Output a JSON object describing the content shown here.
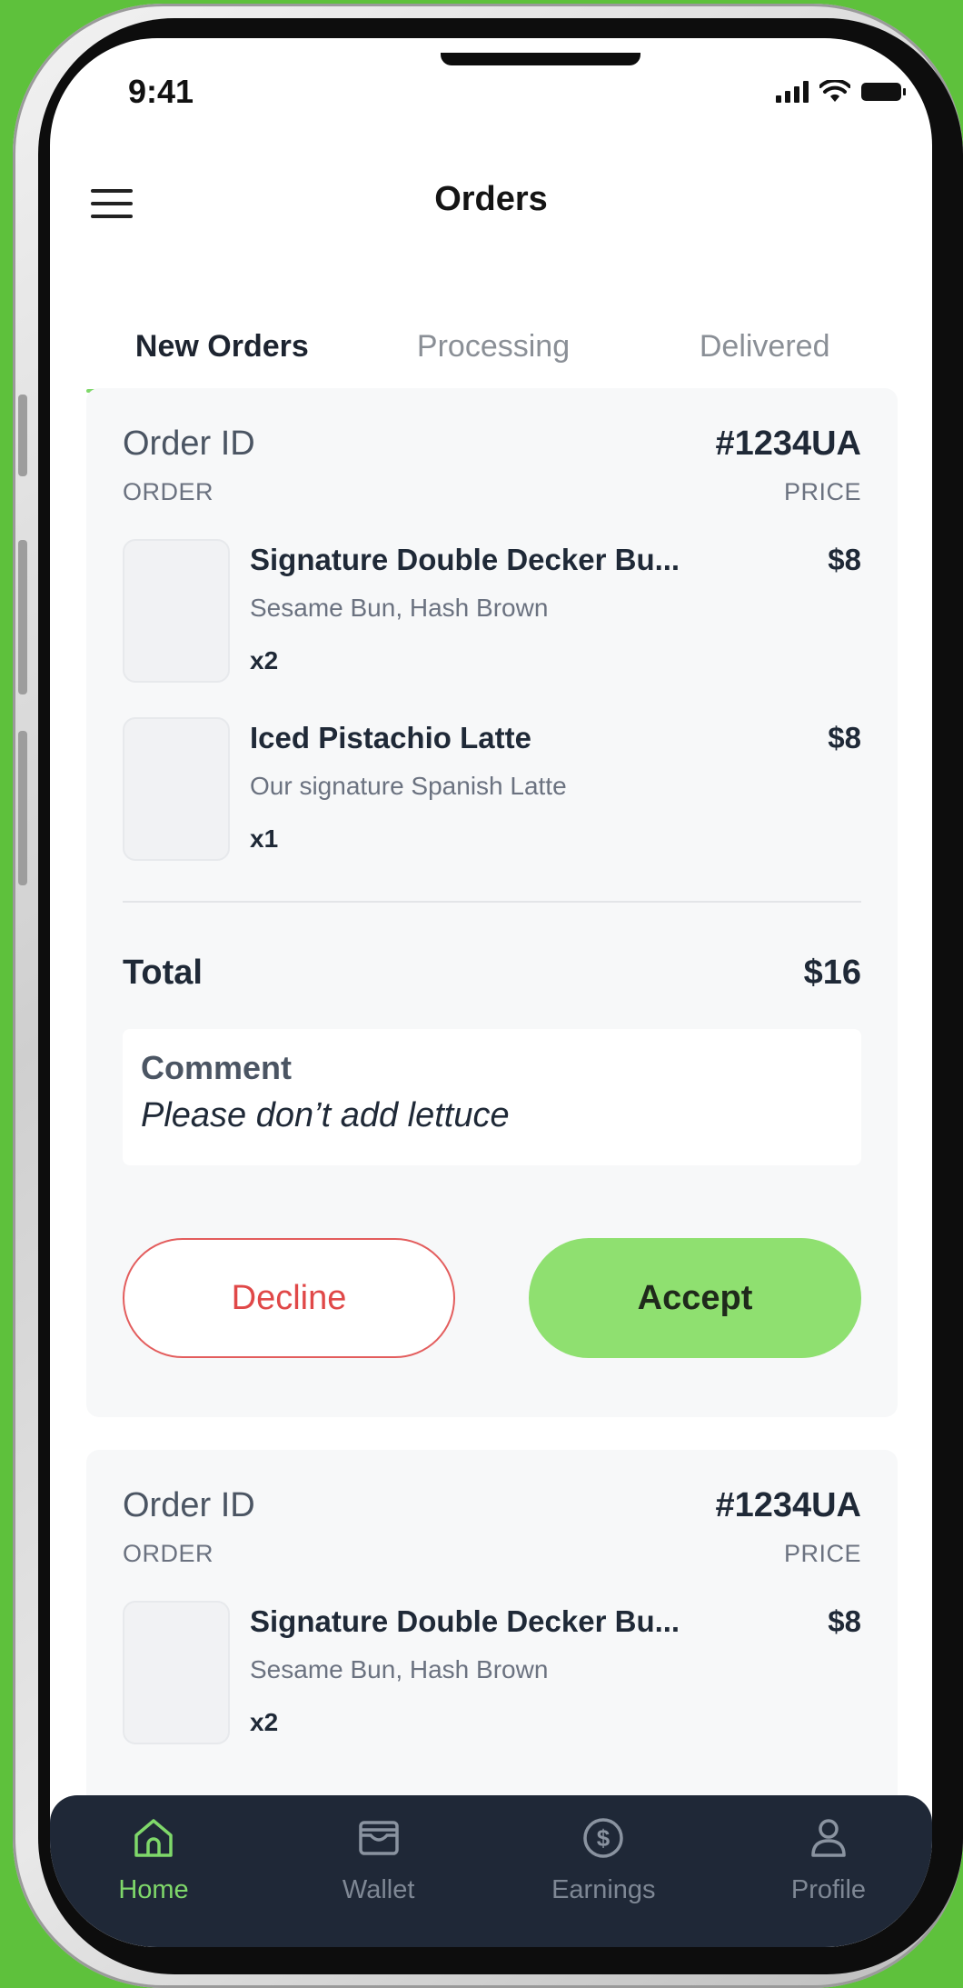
{
  "status_bar": {
    "time": "9:41"
  },
  "header": {
    "title": "Orders"
  },
  "tabs": [
    {
      "label": "New Orders",
      "active": true
    },
    {
      "label": "Processing",
      "active": false
    },
    {
      "label": "Delivered",
      "active": false
    }
  ],
  "orders": [
    {
      "id_label": "Order ID",
      "id_value": "#1234UA",
      "col_order": "ORDER",
      "col_price": "PRICE",
      "items": [
        {
          "name": "Signature Double Decker Bu...",
          "desc": "Sesame Bun, Hash Brown",
          "qty": "x2",
          "price": "$8"
        },
        {
          "name": "Iced Pistachio Latte",
          "desc": "Our signature Spanish Latte",
          "qty": "x1",
          "price": "$8"
        }
      ],
      "total_label": "Total",
      "total_value": "$16",
      "comment_label": "Comment",
      "comment_text": "Please don’t add lettuce",
      "decline_label": "Decline",
      "accept_label": "Accept"
    },
    {
      "id_label": "Order ID",
      "id_value": "#1234UA",
      "col_order": "ORDER",
      "col_price": "PRICE",
      "items": [
        {
          "name": "Signature Double Decker Bu...",
          "desc": "Sesame Bun, Hash Brown",
          "qty": "x2",
          "price": "$8"
        }
      ]
    }
  ],
  "bottom_nav": [
    {
      "label": "Home",
      "icon": "home-icon",
      "active": true
    },
    {
      "label": "Wallet",
      "icon": "wallet-icon",
      "active": false
    },
    {
      "label": "Earnings",
      "icon": "dollar-circle-icon",
      "active": false
    },
    {
      "label": "Profile",
      "icon": "user-icon",
      "active": false
    }
  ],
  "colors": {
    "background": "#5ec13c",
    "accent": "#8fe070",
    "decline": "#e04848",
    "nav_bg": "#1f2837"
  }
}
